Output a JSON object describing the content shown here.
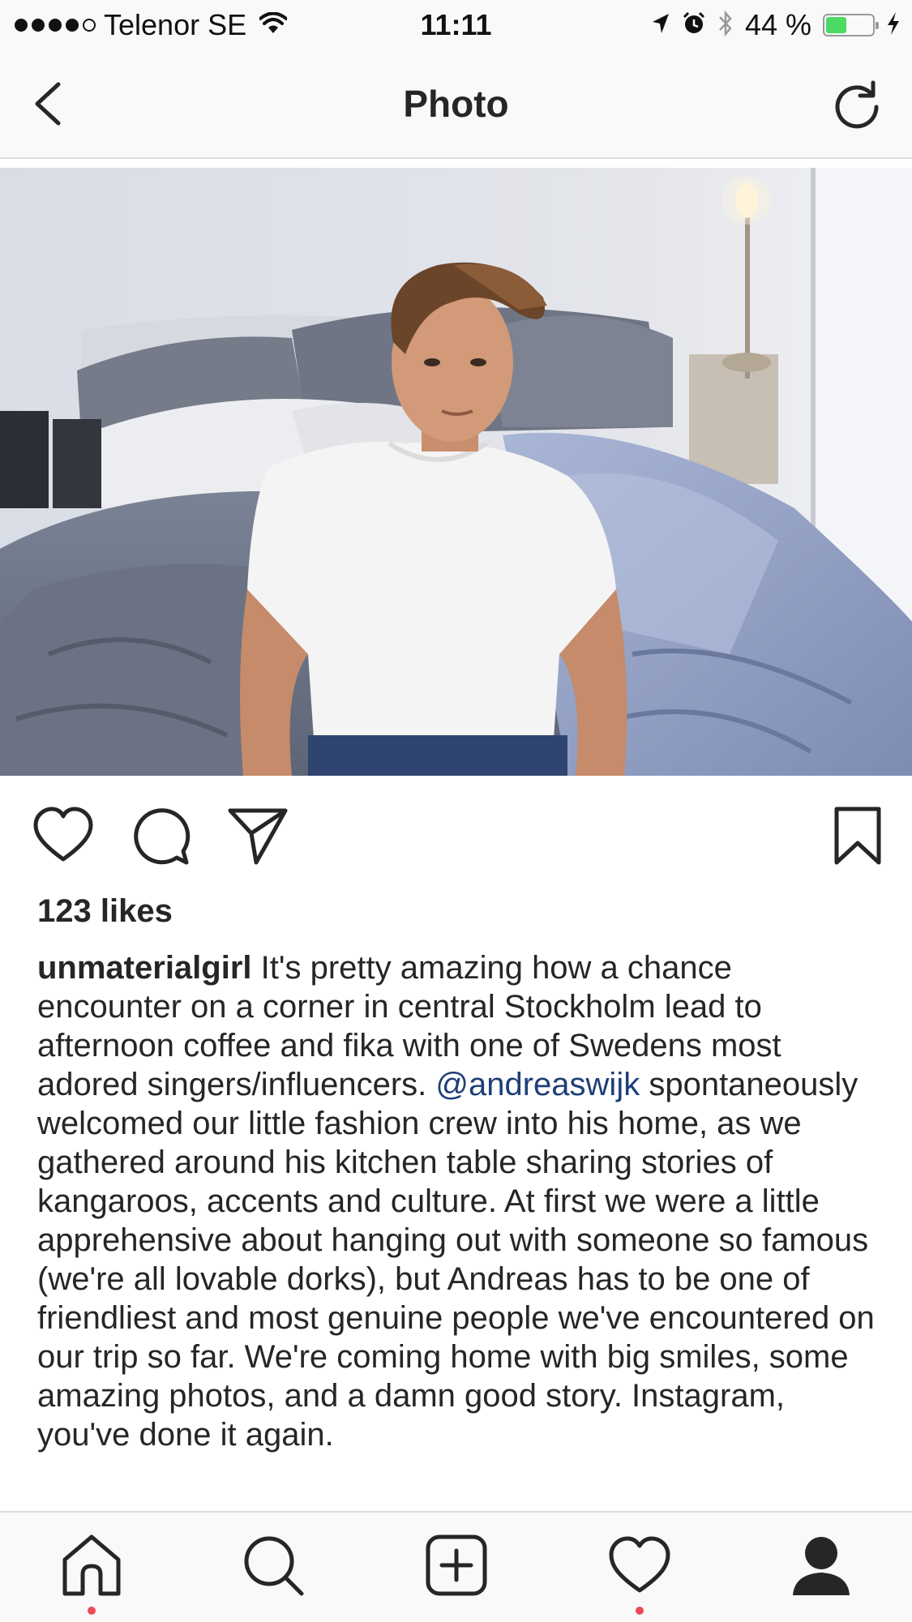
{
  "status_bar": {
    "carrier": "Telenor SE",
    "time": "11:11",
    "battery_percent": "44 %",
    "battery_level": 0.44,
    "signal_bars_filled": 4,
    "signal_bars_total": 5
  },
  "nav": {
    "title": "Photo",
    "back_icon": "chevron-left-icon",
    "refresh_icon": "refresh-icon"
  },
  "post": {
    "likes": "123 likes",
    "username": "unmaterialgirl",
    "caption_part1": " It's pretty amazing how a chance encounter on a corner in central Stockholm lead to afternoon coffee and fika with one of Swedens most adored singers/influencers. ",
    "mention": "@andreaswijk",
    "caption_part2": " spontaneously welcomed our little fashion crew into his home, as we gathered around his kitchen table sharing stories of kangaroos, accents and culture. At first we were a little apprehensive about hanging out with someone so famous (we're all lovable dorks), but Andreas has to be one of friendliest and most genuine people we've encountered on our trip so far. We're coming home with big smiles, some amazing photos, and a damn good story. Instagram, you've done it again."
  },
  "actions": [
    "heart-icon",
    "comment-icon",
    "share-icon",
    "bookmark-icon"
  ],
  "tabbar": [
    "home-icon",
    "search-icon",
    "add-post-icon",
    "activity-heart-icon",
    "profile-icon"
  ],
  "colors": {
    "mention": "#1e3f78",
    "battery_fill": "#4cd964",
    "notification_dot": "#ed4956",
    "bar_background": "#f9f9f9"
  }
}
